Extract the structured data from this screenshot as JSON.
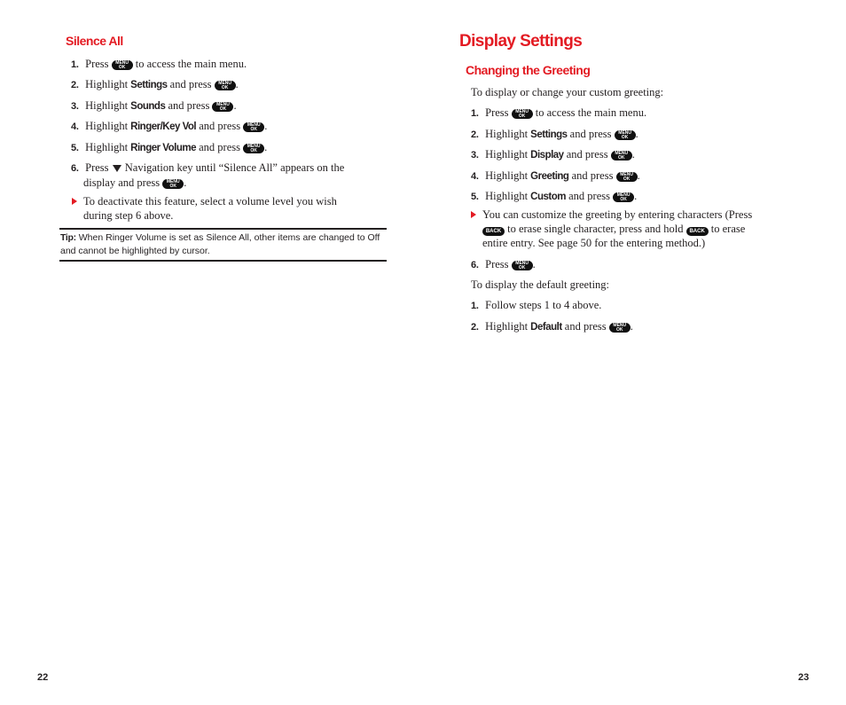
{
  "left_page": {
    "section_title": "Silence All",
    "steps": [
      {
        "num": "1.",
        "pre": "Press ",
        "bold": "",
        "post": " to access the main menu.",
        "key": "menu-ok"
      },
      {
        "num": "2.",
        "pre": "Highlight ",
        "bold": "Settings",
        "post": " and press ",
        "key": "menu-ok"
      },
      {
        "num": "3.",
        "pre": "Highlight ",
        "bold": "Sounds",
        "post": " and press ",
        "key": "menu-ok"
      },
      {
        "num": "4.",
        "pre": "Highlight ",
        "bold": "Ringer/Key Vol",
        "post": " and press ",
        "key": "menu-ok"
      },
      {
        "num": "5.",
        "pre": "Highlight ",
        "bold": "Ringer Volume",
        "post": " and press ",
        "key": "menu-ok"
      },
      {
        "num": "6.",
        "line1_pre": "Press ",
        "line1_post": " Navigation key until “Silence All” appears on the",
        "line2_pre": "display and press ",
        "line2_post": "."
      }
    ],
    "note": {
      "line1": "To deactivate this feature, select a volume level you wish",
      "line2": "during step 6 above."
    },
    "tip": {
      "label": "Tip:",
      "text": " When Ringer Volume is set as Silence All, other items are changed to Off and cannot be highlighted by cursor."
    },
    "page_number": "22"
  },
  "right_page": {
    "page_title": "Display Settings",
    "section_title": "Changing the Greeting",
    "intro": "To display or change your custom greeting:",
    "steps": [
      {
        "num": "1.",
        "pre": "Press ",
        "bold": "",
        "post": " to access the main menu."
      },
      {
        "num": "2.",
        "pre": "Highlight ",
        "bold": "Settings",
        "post": " and press "
      },
      {
        "num": "3.",
        "pre": "Highlight ",
        "bold": "Display",
        "post": " and press "
      },
      {
        "num": "4.",
        "pre": "Highlight ",
        "bold": "Greeting",
        "post": " and press "
      },
      {
        "num": "5.",
        "pre": "Highlight ",
        "bold": "Custom",
        "post": " and press "
      }
    ],
    "note": {
      "line1": "You can customize the greeting by entering characters (Press",
      "line2_mid": " to erase single character, press and hold ",
      "line2_end": " to erase",
      "line3": "entire entry. See page 50 for the entering method.)"
    },
    "step6": {
      "num": "6.",
      "pre": "Press ",
      "post": "."
    },
    "default_intro": "To display the default greeting:",
    "default_steps": [
      {
        "num": "1.",
        "text": "Follow steps 1 to 4 above."
      },
      {
        "num": "2.",
        "pre": "Highlight ",
        "bold": "Default",
        "post": " and press "
      }
    ],
    "page_number": "23"
  },
  "keys": {
    "menu_top": "MENU",
    "menu_bottom": "OK",
    "back": "BACK"
  },
  "colors": {
    "heading_red": "#e31b23",
    "text": "#231f20"
  }
}
